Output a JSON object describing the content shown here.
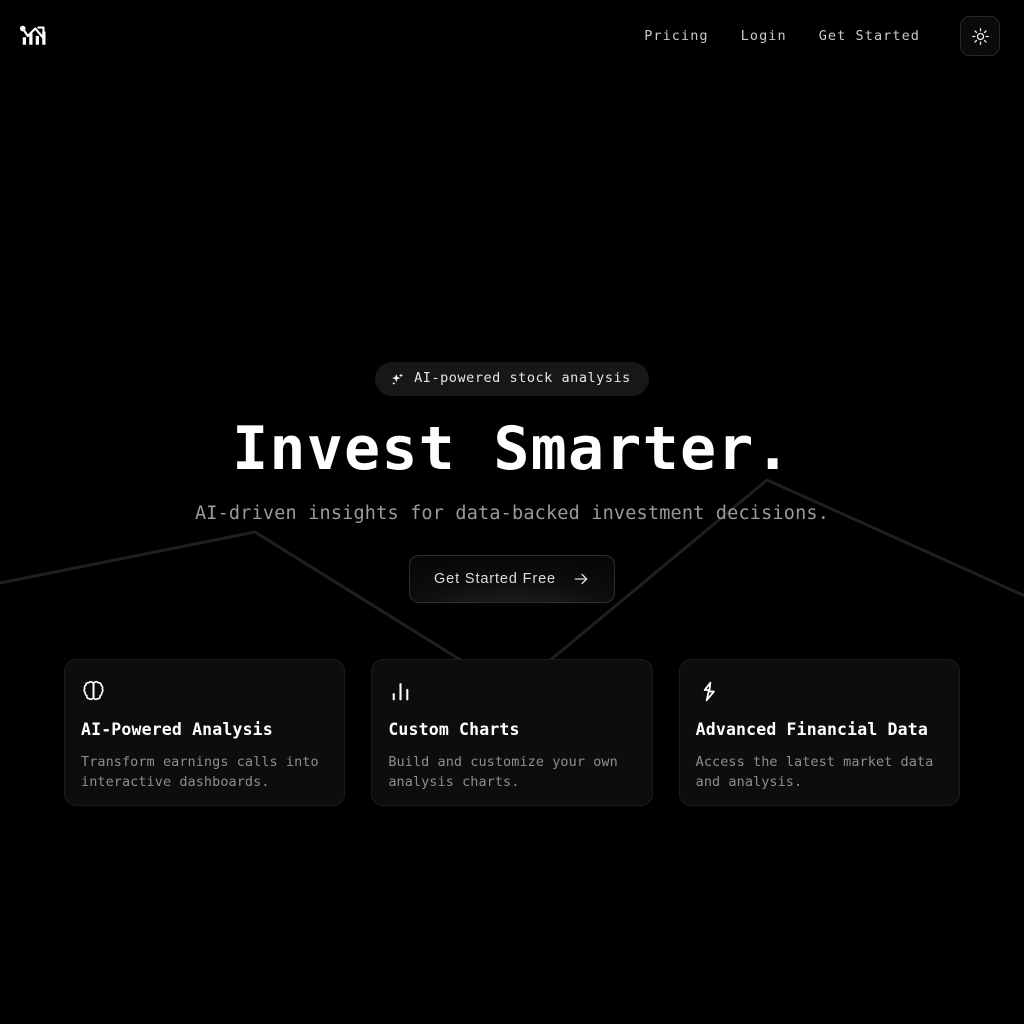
{
  "brand": {
    "logo_icon": "chart-line-up-icon",
    "name": ""
  },
  "header": {
    "nav": [
      {
        "label": "Pricing",
        "name": "nav-link-pricing"
      },
      {
        "label": "Login",
        "name": "nav-link-login"
      },
      {
        "label": "Get Started",
        "name": "nav-link-get-started"
      }
    ],
    "theme_toggle": {
      "icon": "sun-icon",
      "label": "Toggle theme"
    }
  },
  "hero": {
    "badge": {
      "icon": "sparkles-icon",
      "text": "AI-powered stock analysis"
    },
    "headline": "Invest Smarter.",
    "subheadline": "AI-driven insights for data-backed investment decisions.",
    "cta": {
      "label": "Get Started Free",
      "icon": "arrow-right-icon"
    }
  },
  "features": [
    {
      "icon": "brain-icon",
      "title": "AI-Powered Analysis",
      "description": "Transform earnings calls into interactive dashboards."
    },
    {
      "icon": "bar-chart-icon",
      "title": "Custom Charts",
      "description": "Build and customize your own analysis charts."
    },
    {
      "icon": "lightning-bolt-icon",
      "title": "Advanced Financial Data",
      "description": "Access the latest market data and analysis."
    }
  ],
  "colors": {
    "background": "#000000",
    "card_background": "#0d0d0d",
    "card_border": "#1b1b1b",
    "badge_background": "#171717",
    "text_primary": "#ffffff",
    "text_muted": "#8d8d8d",
    "nav_text": "#c9c9c9",
    "accent_line": "#1e1e1e"
  }
}
